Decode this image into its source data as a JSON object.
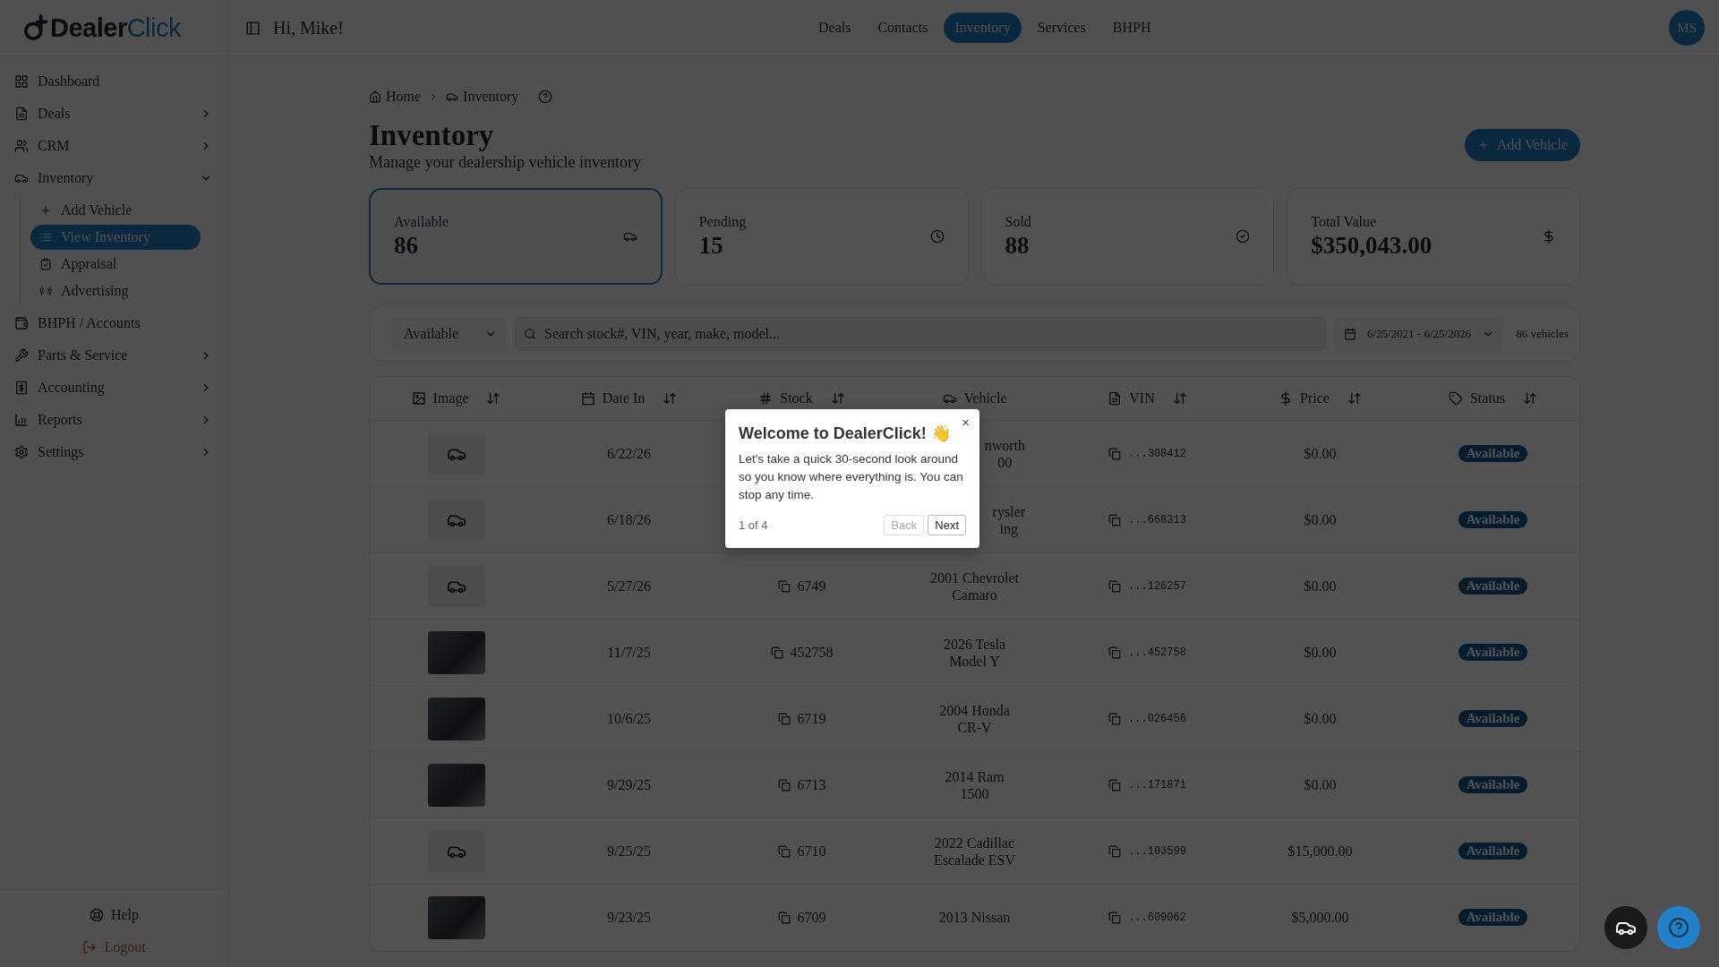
{
  "logo": {
    "text_dark": "Dealer",
    "text_accent": "Click"
  },
  "header": {
    "greeting": "Hi, Mike!",
    "avatar": "MS",
    "nav": [
      {
        "label": "Deals",
        "selected": false
      },
      {
        "label": "Contacts",
        "selected": false
      },
      {
        "label": "Inventory",
        "selected": true
      },
      {
        "label": "Services",
        "selected": false
      },
      {
        "label": "BHPH",
        "selected": false
      }
    ]
  },
  "sidebar": {
    "items": [
      {
        "label": "Dashboard",
        "expandable": false
      },
      {
        "label": "Deals",
        "expandable": true,
        "expanded": false
      },
      {
        "label": "CRM",
        "expandable": true,
        "expanded": false
      },
      {
        "label": "Inventory",
        "expandable": true,
        "expanded": true,
        "children": [
          {
            "label": "Add Vehicle",
            "selected": false
          },
          {
            "label": "View Inventory",
            "selected": true
          },
          {
            "label": "Appraisal",
            "selected": false
          },
          {
            "label": "Advertising",
            "selected": false
          }
        ]
      },
      {
        "label": "BHPH / Accounts",
        "expandable": false
      },
      {
        "label": "Parts & Service",
        "expandable": true,
        "expanded": false
      },
      {
        "label": "Accounting",
        "expandable": true,
        "expanded": false
      },
      {
        "label": "Reports",
        "expandable": true,
        "expanded": false
      },
      {
        "label": "Settings",
        "expandable": true,
        "expanded": false
      }
    ],
    "footer": [
      {
        "label": "Help",
        "kind": "help"
      },
      {
        "label": "Logout",
        "kind": "logout"
      }
    ]
  },
  "breadcrumb": [
    "Home",
    "Inventory"
  ],
  "page": {
    "title": "Inventory",
    "subtitle": "Manage your dealership vehicle inventory",
    "add_button": "Add Vehicle"
  },
  "stats": [
    {
      "label": "Available",
      "value": "86",
      "selected": true
    },
    {
      "label": "Pending",
      "value": "15",
      "selected": false
    },
    {
      "label": "Sold",
      "value": "88",
      "selected": false
    },
    {
      "label": "Total Value",
      "value": "$350,043.00",
      "selected": false
    }
  ],
  "filters": {
    "status": "Available",
    "search": {
      "placeholder": "Search stock#, VIN, year, make, model..."
    },
    "date_range": "6/25/2021 - 6/25/2026",
    "count": "86 vehicles"
  },
  "table": {
    "columns": [
      {
        "label": "Image",
        "sortable": true
      },
      {
        "label": "Date In",
        "sortable": true
      },
      {
        "label": "Stock",
        "sortable": true
      },
      {
        "label": "Vehicle",
        "sortable": false
      },
      {
        "label": "VIN",
        "sortable": true
      },
      {
        "label": "Price",
        "sortable": true
      },
      {
        "label": "Status",
        "sortable": true
      }
    ],
    "rows": [
      {
        "kind": "no_photo",
        "date": "6/22/26",
        "vehicle": "nworth\n00",
        "vin": "...308412",
        "price": "$0.00",
        "status": "Available"
      },
      {
        "kind": "no_photo",
        "date": "6/18/26",
        "vehicle": "rysler\ning",
        "vin": "...668313",
        "price": "$0.00",
        "status": "Available"
      },
      {
        "kind": "no_photo",
        "date": "5/27/26",
        "stock": "6749",
        "vehicle": "2001 Chevrolet\nCamaro",
        "vin": "...126257",
        "price": "$0.00",
        "status": "Available"
      },
      {
        "kind": "photo",
        "date": "11/7/25",
        "stock": "452758",
        "vehicle": "2026 Tesla\nModel Y",
        "vin": "...452758",
        "price": "$0.00",
        "status": "Available"
      },
      {
        "kind": "photo",
        "date": "10/6/25",
        "stock": "6719",
        "vehicle": "2004 Honda\nCR-V",
        "vin": "...026456",
        "price": "$0.00",
        "status": "Available"
      },
      {
        "kind": "photo",
        "date": "9/29/25",
        "stock": "6713",
        "vehicle": "2014 Ram\n1500",
        "vin": "...171871",
        "price": "$0.00",
        "status": "Available"
      },
      {
        "kind": "no_photo",
        "date": "9/25/25",
        "stock": "6710",
        "vehicle": "2022 Cadillac\nEscalade ESV",
        "vin": "...103599",
        "price": "$15,000.00",
        "status": "Available"
      },
      {
        "kind": "photo",
        "date": "9/23/25",
        "stock": "6709",
        "vehicle": "2013 Nissan",
        "vin": "...609062",
        "price": "$5,000.00",
        "status": "Available"
      }
    ]
  },
  "tour": {
    "title": "Welcome to DealerClick! 👋",
    "body": "Let's take a quick 30-second look around so you know where everything is. You can stop any time.",
    "step": "1 of 4",
    "close": "×",
    "buttons": [
      {
        "label": "Back",
        "disabled": true
      },
      {
        "label": "Next",
        "disabled": false
      }
    ]
  }
}
